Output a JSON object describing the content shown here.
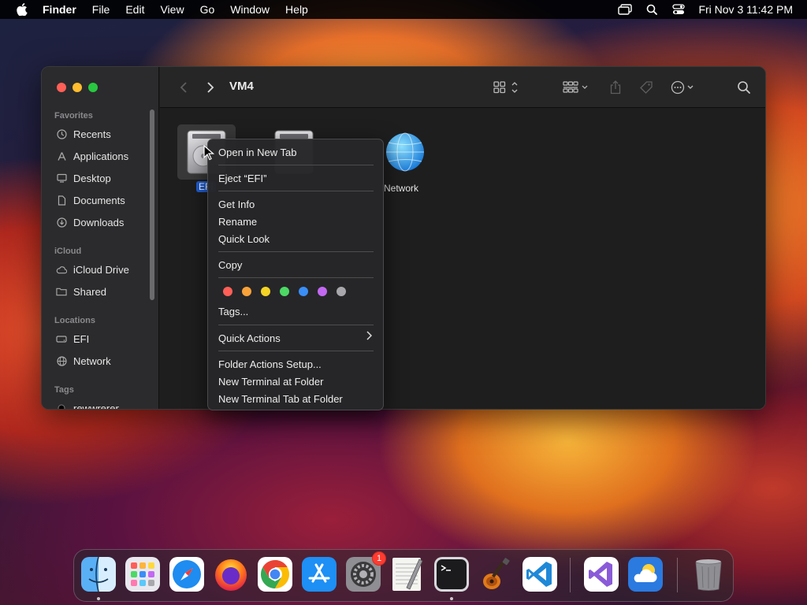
{
  "menubar": {
    "app_name": "Finder",
    "menus": [
      "File",
      "Edit",
      "View",
      "Go",
      "Window",
      "Help"
    ],
    "clock": "Fri Nov 3  11:42 PM"
  },
  "window": {
    "title": "VM4",
    "sidebar": {
      "favorites_header": "Favorites",
      "favorites": [
        {
          "label": "Recents",
          "icon": "clock-icon"
        },
        {
          "label": "Applications",
          "icon": "applications-icon"
        },
        {
          "label": "Desktop",
          "icon": "desktop-icon"
        },
        {
          "label": "Documents",
          "icon": "document-icon"
        },
        {
          "label": "Downloads",
          "icon": "download-icon"
        }
      ],
      "icloud_header": "iCloud",
      "icloud": [
        {
          "label": "iCloud Drive",
          "icon": "cloud-icon"
        },
        {
          "label": "Shared",
          "icon": "shared-folder-icon"
        }
      ],
      "locations_header": "Locations",
      "locations": [
        {
          "label": "EFI",
          "icon": "drive-icon"
        },
        {
          "label": "Network",
          "icon": "globe-icon"
        }
      ],
      "tags_header": "Tags",
      "tags": [
        {
          "label": "rewwrerer",
          "color": "#000000"
        }
      ]
    },
    "files": [
      {
        "label": "EFI",
        "kind": "drive",
        "selected": true
      },
      {
        "label": "",
        "kind": "drive",
        "selected": false
      },
      {
        "label": "Network",
        "kind": "network",
        "selected": false
      }
    ]
  },
  "context_menu": {
    "items": {
      "open_new_tab": "Open in New Tab",
      "eject": "Eject “EFI”",
      "get_info": "Get Info",
      "rename": "Rename",
      "quick_look": "Quick Look",
      "copy": "Copy",
      "tags": "Tags...",
      "quick_actions": "Quick Actions",
      "folder_actions_setup": "Folder Actions Setup...",
      "new_terminal": "New Terminal at Folder",
      "new_terminal_tab": "New Terminal Tab at Folder"
    },
    "tag_colors": [
      "#ff5f57",
      "#f9a23a",
      "#f5d425",
      "#4cd964",
      "#3a8ef6",
      "#c368f2",
      "#a8a8ac"
    ]
  },
  "dock": {
    "apps": [
      {
        "name": "Finder",
        "icon": "finder-icon",
        "running": true
      },
      {
        "name": "Launchpad",
        "icon": "launchpad-icon",
        "running": false
      },
      {
        "name": "Safari",
        "icon": "safari-icon",
        "running": false
      },
      {
        "name": "Firefox",
        "icon": "firefox-icon",
        "running": false
      },
      {
        "name": "Chrome",
        "icon": "chrome-icon",
        "running": false
      },
      {
        "name": "App Store",
        "icon": "app-store-icon",
        "running": false
      },
      {
        "name": "System Settings",
        "icon": "settings-icon",
        "running": false,
        "badge": "1"
      },
      {
        "name": "TextEdit",
        "icon": "textedit-icon",
        "running": false
      },
      {
        "name": "Terminal",
        "icon": "terminal-icon",
        "running": true
      },
      {
        "name": "GarageBand",
        "icon": "guitar-icon",
        "running": false
      },
      {
        "name": "Visual Studio Code",
        "icon": "vscode-icon",
        "running": false
      },
      {
        "name": "Visual Studio",
        "icon": "visual-studio-icon",
        "running": false
      },
      {
        "name": "Weather",
        "icon": "weather-icon",
        "running": false
      },
      {
        "name": "Trash",
        "icon": "trash-icon",
        "running": false
      }
    ]
  }
}
